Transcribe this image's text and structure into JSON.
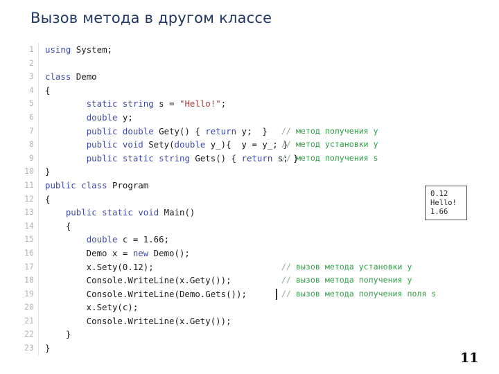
{
  "slide": {
    "title": "Вызов метода в другом классе",
    "title_color": "#1f3864",
    "page_number": "11"
  },
  "code_block": {
    "language": "csharp",
    "keyword_color": "#3c49a8",
    "string_color": "#a33b3b",
    "comment_color": "#2f9e45",
    "gutter_color": "#b3b3b3",
    "lines": [
      {
        "n": "1",
        "tokens": [
          {
            "t": "using",
            "c": "kw"
          },
          {
            "t": " System;",
            "c": "plain"
          }
        ],
        "comment": ""
      },
      {
        "n": "2",
        "tokens": [],
        "comment": ""
      },
      {
        "n": "3",
        "tokens": [
          {
            "t": "class",
            "c": "kw"
          },
          {
            "t": " Demo",
            "c": "plain"
          }
        ],
        "comment": ""
      },
      {
        "n": "4",
        "tokens": [
          {
            "t": "{",
            "c": "plain"
          }
        ],
        "comment": ""
      },
      {
        "n": "5",
        "tokens": [
          {
            "t": "        ",
            "c": "plain"
          },
          {
            "t": "static",
            "c": "kw"
          },
          {
            "t": " ",
            "c": "plain"
          },
          {
            "t": "string",
            "c": "kw"
          },
          {
            "t": " s = ",
            "c": "plain"
          },
          {
            "t": "\"Hello!\"",
            "c": "str"
          },
          {
            "t": ";",
            "c": "plain"
          }
        ],
        "comment": ""
      },
      {
        "n": "6",
        "tokens": [
          {
            "t": "        ",
            "c": "plain"
          },
          {
            "t": "double",
            "c": "kw"
          },
          {
            "t": " y;",
            "c": "plain"
          }
        ],
        "comment": ""
      },
      {
        "n": "7",
        "tokens": [
          {
            "t": "        ",
            "c": "plain"
          },
          {
            "t": "public",
            "c": "kw"
          },
          {
            "t": " ",
            "c": "plain"
          },
          {
            "t": "double",
            "c": "kw"
          },
          {
            "t": " Gety() { ",
            "c": "plain"
          },
          {
            "t": "return",
            "c": "kw"
          },
          {
            "t": " y;  }",
            "c": "plain"
          }
        ],
        "comment": "// метод получения y"
      },
      {
        "n": "8",
        "tokens": [
          {
            "t": "        ",
            "c": "plain"
          },
          {
            "t": "public",
            "c": "kw"
          },
          {
            "t": " ",
            "c": "plain"
          },
          {
            "t": "void",
            "c": "kw"
          },
          {
            "t": " Sety(",
            "c": "plain"
          },
          {
            "t": "double",
            "c": "kw"
          },
          {
            "t": " y_){  y = y_; }",
            "c": "plain"
          }
        ],
        "comment": "// метод установки y"
      },
      {
        "n": "9",
        "tokens": [
          {
            "t": "        ",
            "c": "plain"
          },
          {
            "t": "public",
            "c": "kw"
          },
          {
            "t": " ",
            "c": "plain"
          },
          {
            "t": "static",
            "c": "kw"
          },
          {
            "t": " ",
            "c": "plain"
          },
          {
            "t": "string",
            "c": "kw"
          },
          {
            "t": " Gets() { ",
            "c": "plain"
          },
          {
            "t": "return",
            "c": "kw"
          },
          {
            "t": " s; }",
            "c": "plain"
          }
        ],
        "comment": "// метод получения s"
      },
      {
        "n": "10",
        "tokens": [
          {
            "t": "}",
            "c": "plain"
          }
        ],
        "comment": ""
      },
      {
        "n": "11",
        "tokens": [
          {
            "t": "public",
            "c": "kw"
          },
          {
            "t": " ",
            "c": "plain"
          },
          {
            "t": "class",
            "c": "kw"
          },
          {
            "t": " Program",
            "c": "plain"
          }
        ],
        "comment": ""
      },
      {
        "n": "12",
        "tokens": [
          {
            "t": "{",
            "c": "plain"
          }
        ],
        "comment": ""
      },
      {
        "n": "13",
        "tokens": [
          {
            "t": "    ",
            "c": "plain"
          },
          {
            "t": "public",
            "c": "kw"
          },
          {
            "t": " ",
            "c": "plain"
          },
          {
            "t": "static",
            "c": "kw"
          },
          {
            "t": " ",
            "c": "plain"
          },
          {
            "t": "void",
            "c": "kw"
          },
          {
            "t": " Main()",
            "c": "plain"
          }
        ],
        "comment": ""
      },
      {
        "n": "14",
        "tokens": [
          {
            "t": "    {",
            "c": "plain"
          }
        ],
        "comment": ""
      },
      {
        "n": "15",
        "tokens": [
          {
            "t": "        ",
            "c": "plain"
          },
          {
            "t": "double",
            "c": "kw"
          },
          {
            "t": " c = 1.66;",
            "c": "plain"
          }
        ],
        "comment": ""
      },
      {
        "n": "16",
        "tokens": [
          {
            "t": "        Demo x = ",
            "c": "plain"
          },
          {
            "t": "new",
            "c": "kw"
          },
          {
            "t": " Demo();",
            "c": "plain"
          }
        ],
        "comment": ""
      },
      {
        "n": "17",
        "tokens": [
          {
            "t": "        x.Sety(0.12);",
            "c": "plain"
          }
        ],
        "comment": "// вызов метода установки y"
      },
      {
        "n": "18",
        "tokens": [
          {
            "t": "        Console.WriteLine(x.Gety());",
            "c": "plain"
          }
        ],
        "comment": "// вызов метода получения y"
      },
      {
        "n": "19",
        "tokens": [
          {
            "t": "        Console.WriteLine(Demo.Gets());",
            "c": "plain"
          }
        ],
        "comment": "// вызов метода получения поля s",
        "caret": true
      },
      {
        "n": "20",
        "tokens": [
          {
            "t": "        x.Sety(c);",
            "c": "plain"
          }
        ],
        "comment": ""
      },
      {
        "n": "21",
        "tokens": [
          {
            "t": "        Console.WriteLine(x.Gety());",
            "c": "plain"
          }
        ],
        "comment": ""
      },
      {
        "n": "22",
        "tokens": [
          {
            "t": "    }",
            "c": "plain"
          }
        ],
        "comment": ""
      },
      {
        "n": "23",
        "tokens": [
          {
            "t": "}",
            "c": "plain"
          }
        ],
        "comment": ""
      }
    ]
  },
  "console_output": {
    "lines": [
      "0.12",
      "Hello!",
      "1.66"
    ]
  }
}
